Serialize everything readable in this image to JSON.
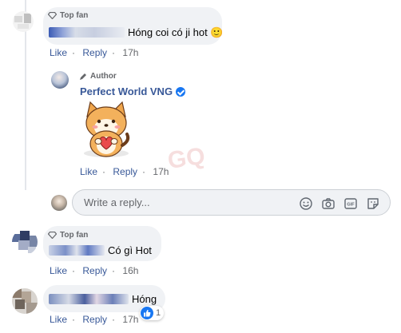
{
  "comments": [
    {
      "badge": "Top fan",
      "text": "Hóng coi có ji hot 🙂",
      "actions": {
        "like": "Like",
        "reply": "Reply",
        "time": "17h"
      }
    },
    {
      "badge": "Author",
      "name": "Perfect World VNG",
      "actions": {
        "like": "Like",
        "reply": "Reply",
        "time": "17h"
      }
    },
    {
      "badge": "Top fan",
      "text": "Có gì Hot",
      "actions": {
        "like": "Like",
        "reply": "Reply",
        "time": "16h"
      }
    },
    {
      "text": "Hóng",
      "reaction_count": "1",
      "actions": {
        "like": "Like",
        "reply": "Reply",
        "time": "17h"
      }
    }
  ],
  "reply_box": {
    "placeholder": "Write a reply..."
  },
  "colors": {
    "link": "#385898",
    "bubble": "#f0f2f5",
    "verified": "#1877f2",
    "meta": "#65676b"
  },
  "icons": [
    "diamond-icon",
    "pencil-icon",
    "verified-icon",
    "emoji-icon",
    "camera-icon",
    "gif-icon",
    "sticker-icon",
    "like-reaction-icon"
  ]
}
